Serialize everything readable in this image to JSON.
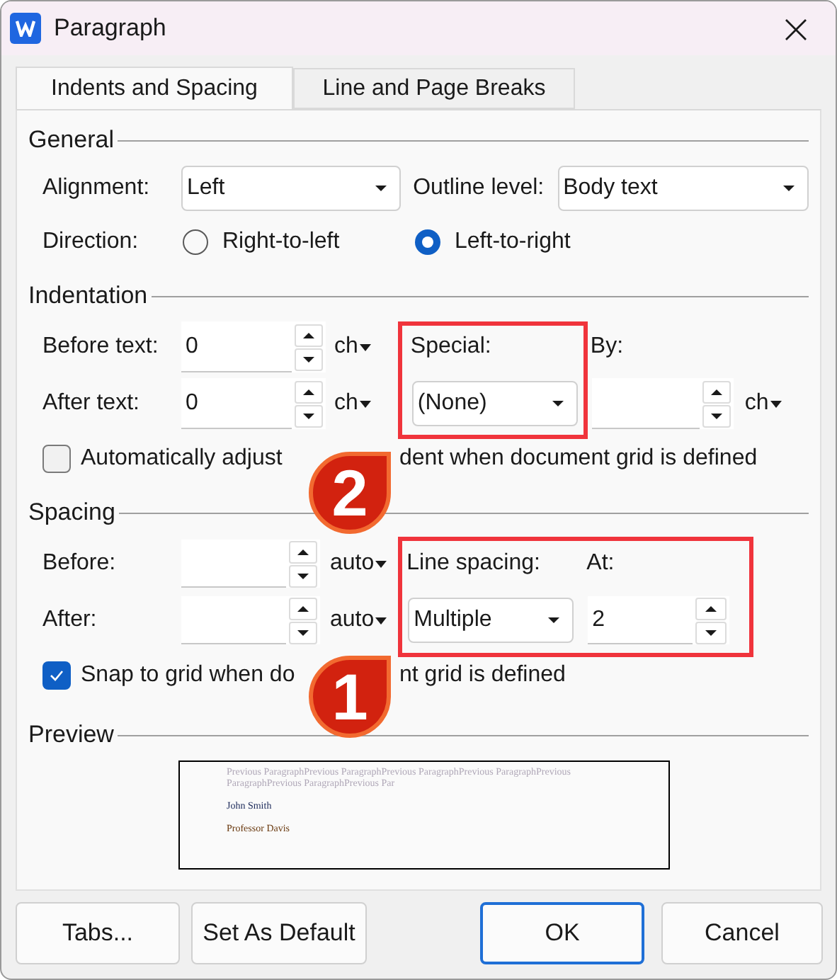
{
  "window": {
    "title": "Paragraph"
  },
  "tabs": [
    {
      "label": "Indents and Spacing",
      "selected": true
    },
    {
      "label": "Line and Page Breaks",
      "selected": false
    }
  ],
  "general": {
    "title": "General",
    "alignment": {
      "label": "Alignment:",
      "value": "Left"
    },
    "outline_level": {
      "label": "Outline level:",
      "value": "Body text"
    },
    "direction": {
      "label": "Direction:",
      "options": [
        {
          "label": "Right-to-left",
          "selected": false
        },
        {
          "label": "Left-to-right",
          "selected": true
        }
      ]
    }
  },
  "indentation": {
    "title": "Indentation",
    "before_text": {
      "label": "Before text:",
      "value": "0",
      "unit": "ch"
    },
    "after_text": {
      "label": "After text:",
      "value": "0",
      "unit": "ch"
    },
    "special": {
      "label": "Special:",
      "value": "(None)"
    },
    "by": {
      "label": "By:",
      "unit": "ch"
    },
    "auto_adjust": {
      "label_parts": [
        "Automatically adjust",
        "dent when document grid is defined"
      ],
      "checked": false
    }
  },
  "spacing": {
    "title": "Spacing",
    "before": {
      "label": "Before:",
      "unit": "auto"
    },
    "after": {
      "label": "After:",
      "unit": "auto"
    },
    "line_spacing": {
      "label": "Line spacing:",
      "value": "Multiple"
    },
    "at": {
      "label": "At:",
      "value": "2"
    },
    "snap_to_grid": {
      "label_parts": [
        "Snap to grid when do",
        "nt grid is defined"
      ],
      "checked": true
    }
  },
  "preview": {
    "title": "Preview",
    "previous_text": [
      "Previous ParagraphPrevious ParagraphPrevious ParagraphPrevious ParagraphPrevious",
      "ParagraphPrevious ParagraphPrevious Par"
    ],
    "lines": [
      "John Smith",
      "Professor Davis"
    ]
  },
  "callouts": [
    {
      "number": "2"
    },
    {
      "number": "1"
    }
  ],
  "buttons": [
    {
      "label": "Tabs...",
      "kind": "normal"
    },
    {
      "label": "Set As Default",
      "kind": "normal"
    },
    {
      "label": "OK",
      "kind": "default"
    },
    {
      "label": "Cancel",
      "kind": "normal"
    }
  ]
}
